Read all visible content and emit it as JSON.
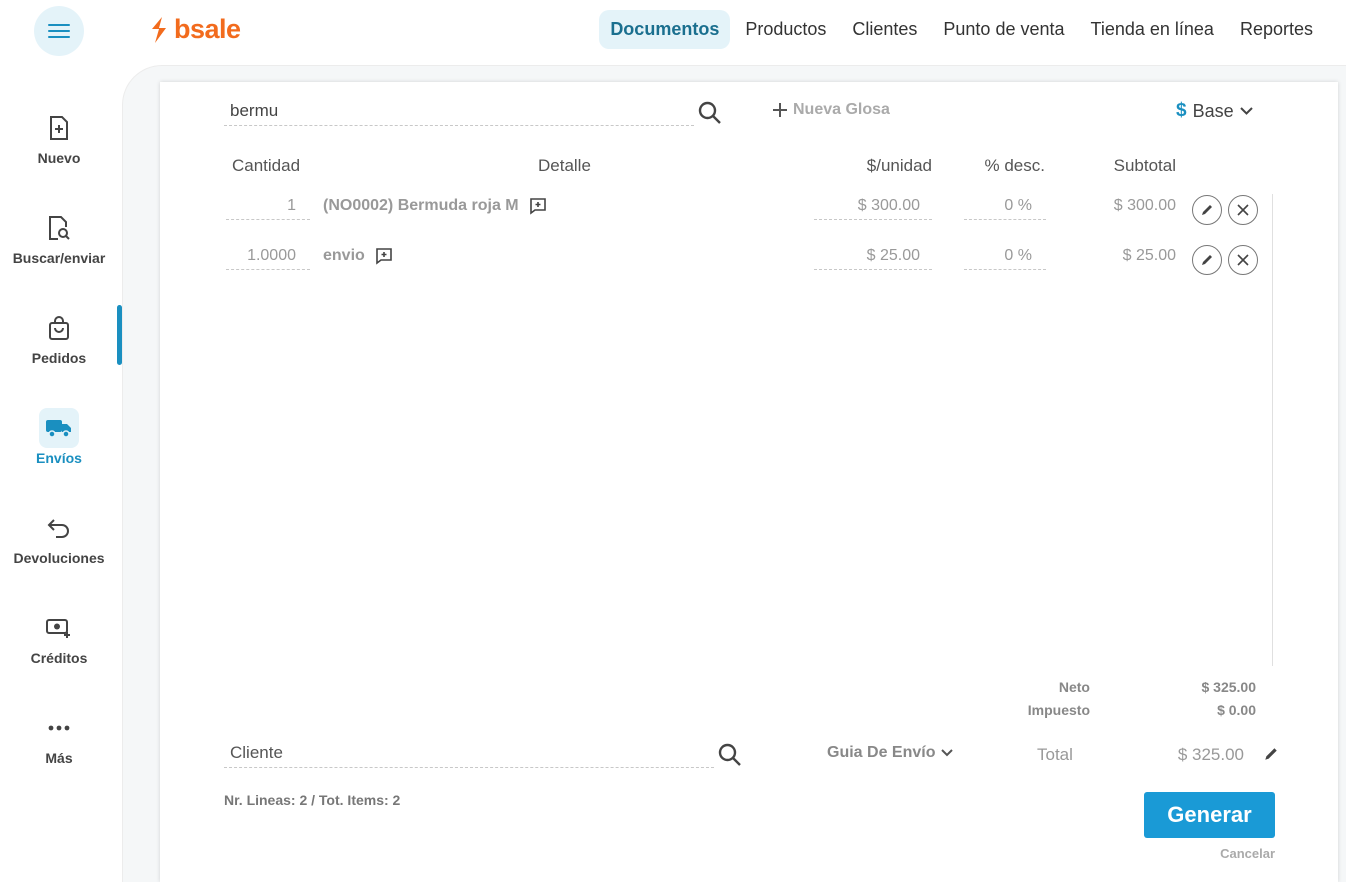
{
  "brand": {
    "name": "bsale",
    "color": "#f26b1d",
    "accent": "#1a9ad6"
  },
  "topnav": {
    "items": [
      {
        "label": "Documentos",
        "active": true
      },
      {
        "label": "Productos",
        "active": false
      },
      {
        "label": "Clientes",
        "active": false
      },
      {
        "label": "Punto de venta",
        "active": false
      },
      {
        "label": "Tienda en línea",
        "active": false
      },
      {
        "label": "Reportes",
        "active": false
      }
    ]
  },
  "sidebar": {
    "items": [
      {
        "label": "Nuevo",
        "icon": "file-plus-icon",
        "active": false
      },
      {
        "label": "Buscar/enviar",
        "icon": "file-search-icon",
        "active": false
      },
      {
        "label": "Pedidos",
        "icon": "shopping-bag-icon",
        "active": false
      },
      {
        "label": "Envíos",
        "icon": "truck-icon",
        "active": true
      },
      {
        "label": "Devoluciones",
        "icon": "return-arrow-icon",
        "active": false
      },
      {
        "label": "Créditos",
        "icon": "money-plus-icon",
        "active": false
      },
      {
        "label": "Más",
        "icon": "more-dots-icon",
        "active": false
      }
    ]
  },
  "editor": {
    "product_search": {
      "value": "bermu"
    },
    "nueva_glosa": "Nueva Glosa",
    "price_list": {
      "symbol": "$",
      "label": "Base"
    },
    "columns": {
      "cantidad": "Cantidad",
      "detalle": "Detalle",
      "unidad": "$/unidad",
      "desc": "% desc.",
      "subtotal": "Subtotal"
    },
    "lines": [
      {
        "cantidad": "1",
        "detalle": "(NO0002) Bermuda roja M",
        "unidad": "$ 300.00",
        "desc": "0 %",
        "subtotal": "$ 300.00"
      },
      {
        "cantidad": "1.0000",
        "detalle": "envio",
        "unidad": "$ 25.00",
        "desc": "0 %",
        "subtotal": "$ 25.00"
      }
    ],
    "totals": {
      "neto_label": "Neto",
      "neto": "$ 325.00",
      "impuesto_label": "Impuesto",
      "impuesto": "$ 0.00",
      "total_label": "Total",
      "total": "$ 325.00"
    },
    "cliente": {
      "value": "Cliente"
    },
    "doc_type": "Guia De Envío",
    "summary": "Nr. Lineas: 2 / Tot. Items: 2",
    "generar": "Generar",
    "cancelar": "Cancelar"
  }
}
